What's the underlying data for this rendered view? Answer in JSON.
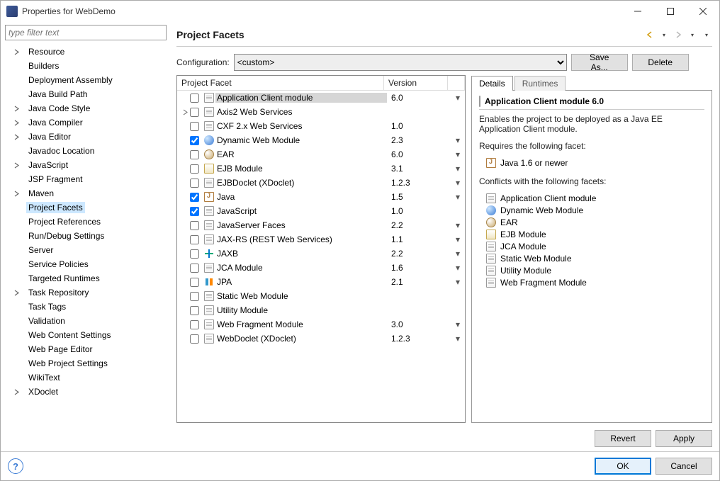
{
  "window": {
    "title": "Properties for WebDemo"
  },
  "sidebar": {
    "filter_placeholder": "type filter text",
    "items": [
      {
        "label": "Resource",
        "expandable": true
      },
      {
        "label": "Builders",
        "expandable": false
      },
      {
        "label": "Deployment Assembly",
        "expandable": false
      },
      {
        "label": "Java Build Path",
        "expandable": false
      },
      {
        "label": "Java Code Style",
        "expandable": true
      },
      {
        "label": "Java Compiler",
        "expandable": true
      },
      {
        "label": "Java Editor",
        "expandable": true
      },
      {
        "label": "Javadoc Location",
        "expandable": false
      },
      {
        "label": "JavaScript",
        "expandable": true
      },
      {
        "label": "JSP Fragment",
        "expandable": false
      },
      {
        "label": "Maven",
        "expandable": true
      },
      {
        "label": "Project Facets",
        "expandable": false,
        "selected": true
      },
      {
        "label": "Project References",
        "expandable": false
      },
      {
        "label": "Run/Debug Settings",
        "expandable": false
      },
      {
        "label": "Server",
        "expandable": false
      },
      {
        "label": "Service Policies",
        "expandable": false
      },
      {
        "label": "Targeted Runtimes",
        "expandable": false
      },
      {
        "label": "Task Repository",
        "expandable": true
      },
      {
        "label": "Task Tags",
        "expandable": false
      },
      {
        "label": "Validation",
        "expandable": false
      },
      {
        "label": "Web Content Settings",
        "expandable": false
      },
      {
        "label": "Web Page Editor",
        "expandable": false
      },
      {
        "label": "Web Project Settings",
        "expandable": false
      },
      {
        "label": "WikiText",
        "expandable": false
      },
      {
        "label": "XDoclet",
        "expandable": true
      }
    ]
  },
  "page": {
    "title": "Project Facets",
    "config_label": "Configuration:",
    "config_value": "<custom>",
    "save_as": "Save As...",
    "delete": "Delete",
    "revert": "Revert",
    "apply": "Apply",
    "ok": "OK",
    "cancel": "Cancel"
  },
  "table": {
    "col_facet": "Project Facet",
    "col_version": "Version",
    "rows": [
      {
        "name": "Application Client module",
        "version": "6.0",
        "checked": false,
        "dd": true,
        "icon": "doc",
        "expandable": false,
        "selected": true
      },
      {
        "name": "Axis2 Web Services",
        "version": "",
        "checked": false,
        "dd": false,
        "icon": "doc",
        "expandable": true
      },
      {
        "name": "CXF 2.x Web Services",
        "version": "1.0",
        "checked": false,
        "dd": false,
        "icon": "doc",
        "expandable": false
      },
      {
        "name": "Dynamic Web Module",
        "version": "2.3",
        "checked": true,
        "dd": true,
        "icon": "web",
        "expandable": false
      },
      {
        "name": "EAR",
        "version": "6.0",
        "checked": false,
        "dd": true,
        "icon": "ear",
        "expandable": false
      },
      {
        "name": "EJB Module",
        "version": "3.1",
        "checked": false,
        "dd": true,
        "icon": "ejb",
        "expandable": false
      },
      {
        "name": "EJBDoclet (XDoclet)",
        "version": "1.2.3",
        "checked": false,
        "dd": true,
        "icon": "doc",
        "expandable": false
      },
      {
        "name": "Java",
        "version": "1.5",
        "checked": true,
        "dd": true,
        "icon": "java",
        "expandable": false
      },
      {
        "name": "JavaScript",
        "version": "1.0",
        "checked": true,
        "dd": false,
        "icon": "doc",
        "expandable": false
      },
      {
        "name": "JavaServer Faces",
        "version": "2.2",
        "checked": false,
        "dd": true,
        "icon": "doc",
        "expandable": false
      },
      {
        "name": "JAX-RS (REST Web Services)",
        "version": "1.1",
        "checked": false,
        "dd": true,
        "icon": "doc",
        "expandable": false
      },
      {
        "name": "JAXB",
        "version": "2.2",
        "checked": false,
        "dd": true,
        "icon": "ax",
        "expandable": false
      },
      {
        "name": "JCA Module",
        "version": "1.6",
        "checked": false,
        "dd": true,
        "icon": "doc",
        "expandable": false
      },
      {
        "name": "JPA",
        "version": "2.1",
        "checked": false,
        "dd": true,
        "icon": "jpa",
        "expandable": false
      },
      {
        "name": "Static Web Module",
        "version": "",
        "checked": false,
        "dd": false,
        "icon": "doc",
        "expandable": false
      },
      {
        "name": "Utility Module",
        "version": "",
        "checked": false,
        "dd": false,
        "icon": "doc",
        "expandable": false
      },
      {
        "name": "Web Fragment Module",
        "version": "3.0",
        "checked": false,
        "dd": true,
        "icon": "doc",
        "expandable": false
      },
      {
        "name": "WebDoclet (XDoclet)",
        "version": "1.2.3",
        "checked": false,
        "dd": true,
        "icon": "doc",
        "expandable": false
      }
    ]
  },
  "details": {
    "tab_details": "Details",
    "tab_runtimes": "Runtimes",
    "title": "Application Client module 6.0",
    "description": "Enables the project to be deployed as a Java EE Application Client module.",
    "requires_label": "Requires the following facet:",
    "requires": [
      {
        "label": "Java 1.6 or newer",
        "icon": "java"
      }
    ],
    "conflicts_label": "Conflicts with the following facets:",
    "conflicts": [
      {
        "label": "Application Client module",
        "icon": "doc"
      },
      {
        "label": "Dynamic Web Module",
        "icon": "web"
      },
      {
        "label": "EAR",
        "icon": "ear"
      },
      {
        "label": "EJB Module",
        "icon": "ejb"
      },
      {
        "label": "JCA Module",
        "icon": "doc"
      },
      {
        "label": "Static Web Module",
        "icon": "doc"
      },
      {
        "label": "Utility Module",
        "icon": "doc"
      },
      {
        "label": "Web Fragment Module",
        "icon": "doc"
      }
    ]
  }
}
